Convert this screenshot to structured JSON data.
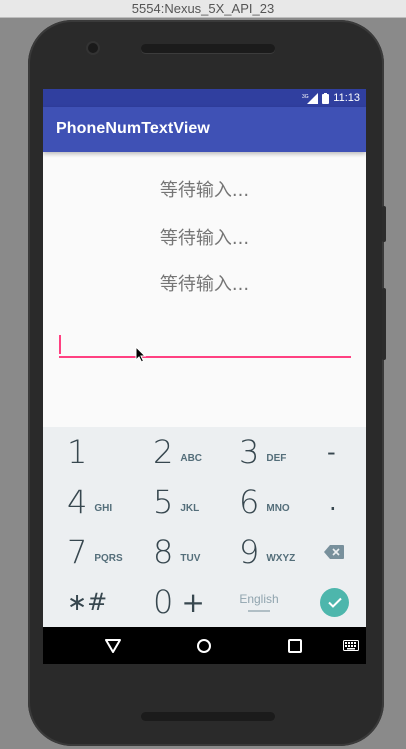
{
  "window": {
    "title": "5554:Nexus_5X_API_23"
  },
  "statusbar": {
    "time": "11:13",
    "network": "3G"
  },
  "appbar": {
    "title": "PhoneNumTextView"
  },
  "content": {
    "status_lines": [
      "等待输入...",
      "等待输入...",
      "等待输入..."
    ],
    "phone_input_value": ""
  },
  "keyboard": {
    "rows": [
      [
        {
          "digit": "1",
          "letters": ""
        },
        {
          "digit": "2",
          "letters": "ABC"
        },
        {
          "digit": "3",
          "letters": "DEF"
        },
        {
          "sym": "-"
        }
      ],
      [
        {
          "digit": "4",
          "letters": "GHI"
        },
        {
          "digit": "5",
          "letters": "JKL"
        },
        {
          "digit": "6",
          "letters": "MNO"
        },
        {
          "sym": "."
        }
      ],
      [
        {
          "digit": "7",
          "letters": "PQRS"
        },
        {
          "digit": "8",
          "letters": "TUV"
        },
        {
          "digit": "9",
          "letters": "WXYZ"
        },
        {
          "icon": "backspace-icon"
        }
      ],
      [
        {
          "sym": "∗#"
        },
        {
          "digit": "0",
          "plus": "+"
        },
        {
          "lang": "English"
        },
        {
          "icon": "check-icon"
        }
      ]
    ]
  },
  "colors": {
    "primary": "#3f51b5",
    "primary_dark": "#303f9f",
    "accent": "#ff4081",
    "done_button": "#4db6ac"
  },
  "navbar": {
    "buttons": [
      "back-icon",
      "home-icon",
      "recents-icon",
      "keyboard-switch-icon"
    ]
  }
}
